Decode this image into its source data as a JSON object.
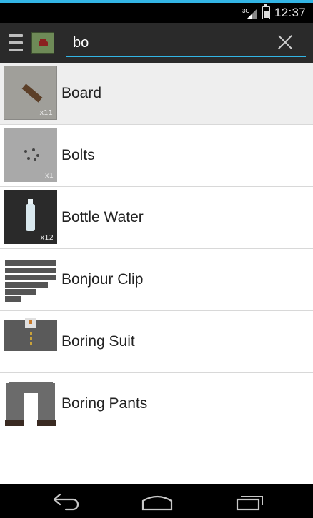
{
  "status_bar": {
    "network": "3G",
    "time": "12:37"
  },
  "action_bar": {
    "search_value": "bo",
    "menu_icon": "hamburger-icon",
    "app_icon": "app-icon"
  },
  "items": [
    {
      "name": "Board",
      "qty": "x11",
      "thumb": "board"
    },
    {
      "name": "Bolts",
      "qty": "x1",
      "thumb": "bolts"
    },
    {
      "name": "Bottle Water",
      "qty": "x12",
      "thumb": "water"
    },
    {
      "name": "Bonjour Clip",
      "qty": "",
      "thumb": "clip"
    },
    {
      "name": "Boring Suit",
      "qty": "",
      "thumb": "suit"
    },
    {
      "name": "Boring Pants",
      "qty": "",
      "thumb": "pants"
    }
  ],
  "nav_bar": {
    "icons": [
      "back-icon",
      "home-icon",
      "recents-icon"
    ]
  },
  "colors": {
    "accent": "#33b5e5",
    "action_bar": "#2a2a2a",
    "selected_row": "#eeeeee"
  }
}
